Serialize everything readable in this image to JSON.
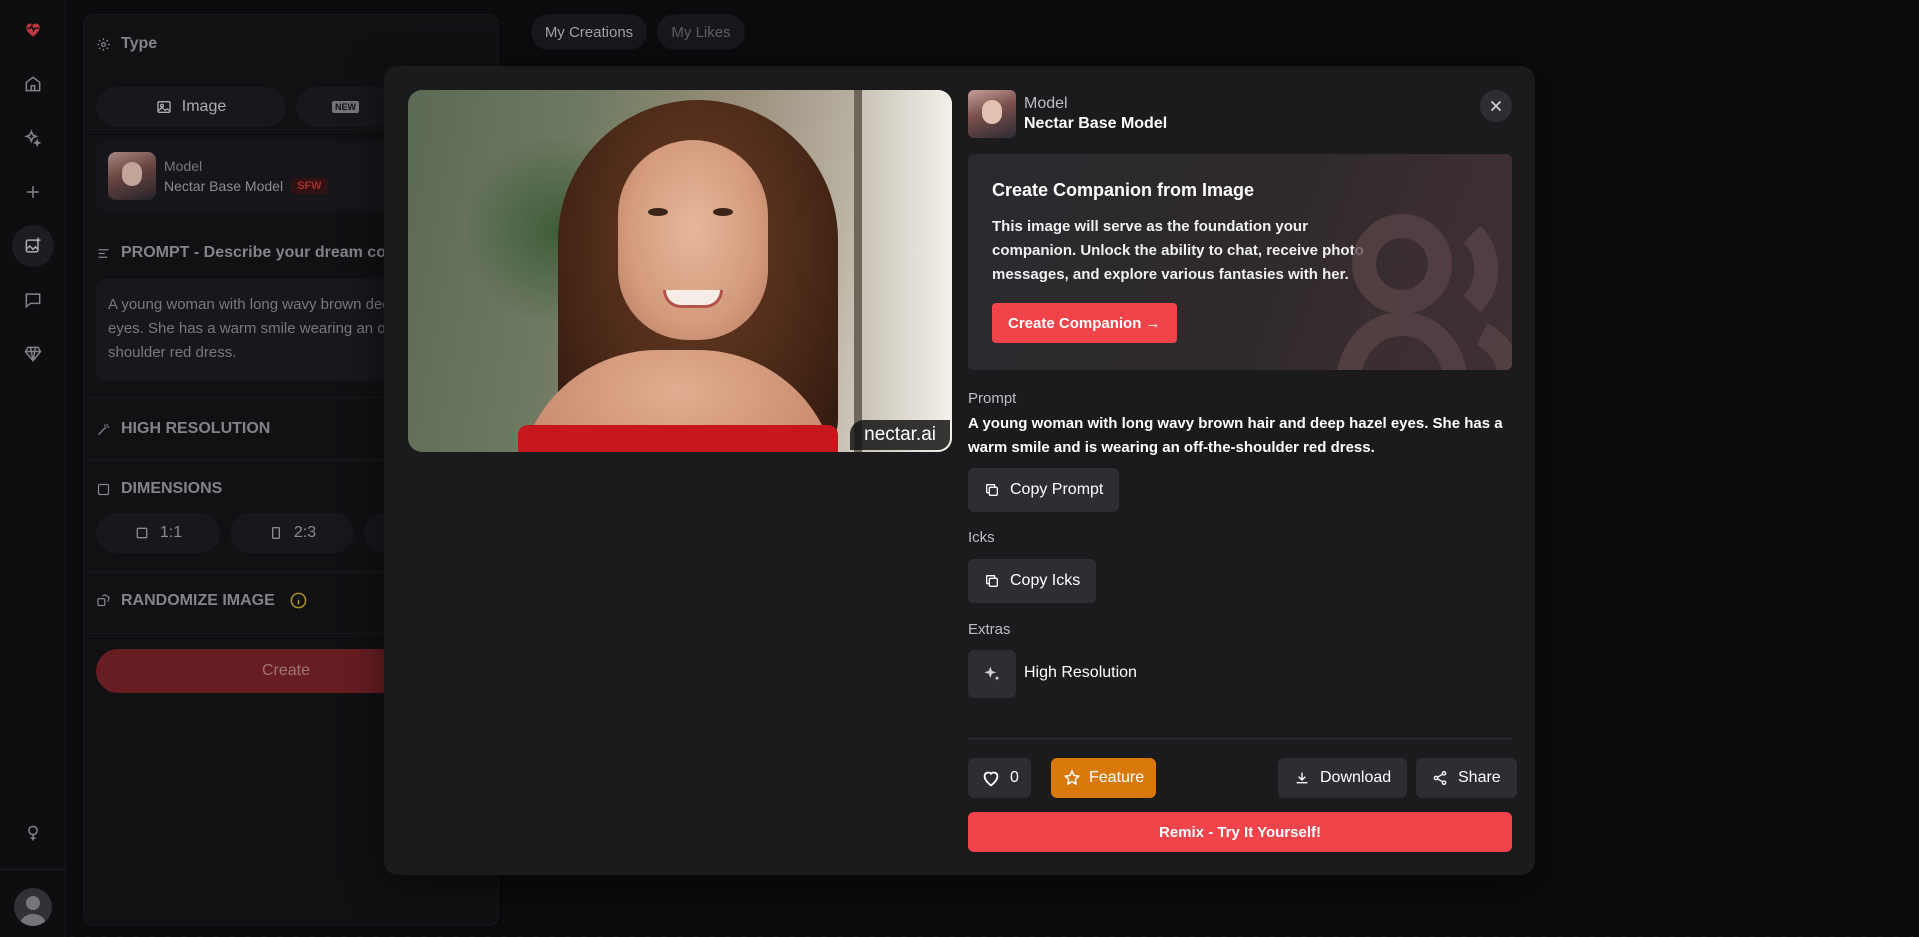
{
  "sidebar_nav": {
    "items": [
      {
        "name": "logo",
        "icon": "heart-pulse-icon"
      },
      {
        "name": "home",
        "icon": "home-icon"
      },
      {
        "name": "explore",
        "icon": "sparkles-icon"
      },
      {
        "name": "create",
        "icon": "plus-icon"
      },
      {
        "name": "image-generator",
        "icon": "image-plus-icon",
        "active": true
      },
      {
        "name": "chat",
        "icon": "chat-icon"
      },
      {
        "name": "premium",
        "icon": "gem-icon"
      }
    ],
    "bottom": [
      {
        "name": "gender",
        "icon": "female-icon"
      },
      {
        "name": "account",
        "icon": "user-avatar-icon"
      }
    ]
  },
  "top_tabs": [
    "My Creations",
    "My Likes"
  ],
  "generator_panel": {
    "type_title": "Type",
    "type_options": [
      "Image"
    ],
    "model": {
      "label": "Model",
      "name": "Nectar Base Model",
      "badge": "SFW"
    },
    "prompt_title": "PROMPT - Describe your dream con",
    "prompt_text": "A young woman with long wavy brown deep hazel eyes. She has a warm smile wearing an off-the-shoulder red dress.",
    "high_resolution_title": "HIGH RESOLUTION",
    "dimensions_title": "DIMENSIONS",
    "dimension_options": [
      "1:1",
      "2:3"
    ],
    "randomize_title": "RANDOMIZE IMAGE",
    "create_label": "Create"
  },
  "modal": {
    "image_watermark": "nectar.ai",
    "model": {
      "label": "Model",
      "name": "Nectar Base Model"
    },
    "companion_card": {
      "title": "Create Companion from Image",
      "description": "This image will serve as the foundation your companion. Unlock the ability to chat, receive photo messages, and explore various fantasies with her.",
      "button_label": "Create Companion →"
    },
    "prompt_label": "Prompt",
    "prompt_text": "A young woman with long wavy brown hair and deep hazel eyes. She has a warm smile and is wearing an off-the-shoulder red dress.",
    "copy_prompt_label": "Copy Prompt",
    "icks_label": "Icks",
    "copy_icks_label": "Copy Icks",
    "extras_label": "Extras",
    "extras": [
      "High Resolution"
    ],
    "like_count": "0",
    "feature_label": "Feature",
    "download_label": "Download",
    "share_label": "Share",
    "remix_label": "Remix - Try It Yourself!"
  },
  "colors": {
    "accent_red": "#f0434a",
    "feature_orange": "#d9790c",
    "modal_bg": "#1b1b1e",
    "page_bg": "#0d0d10"
  }
}
